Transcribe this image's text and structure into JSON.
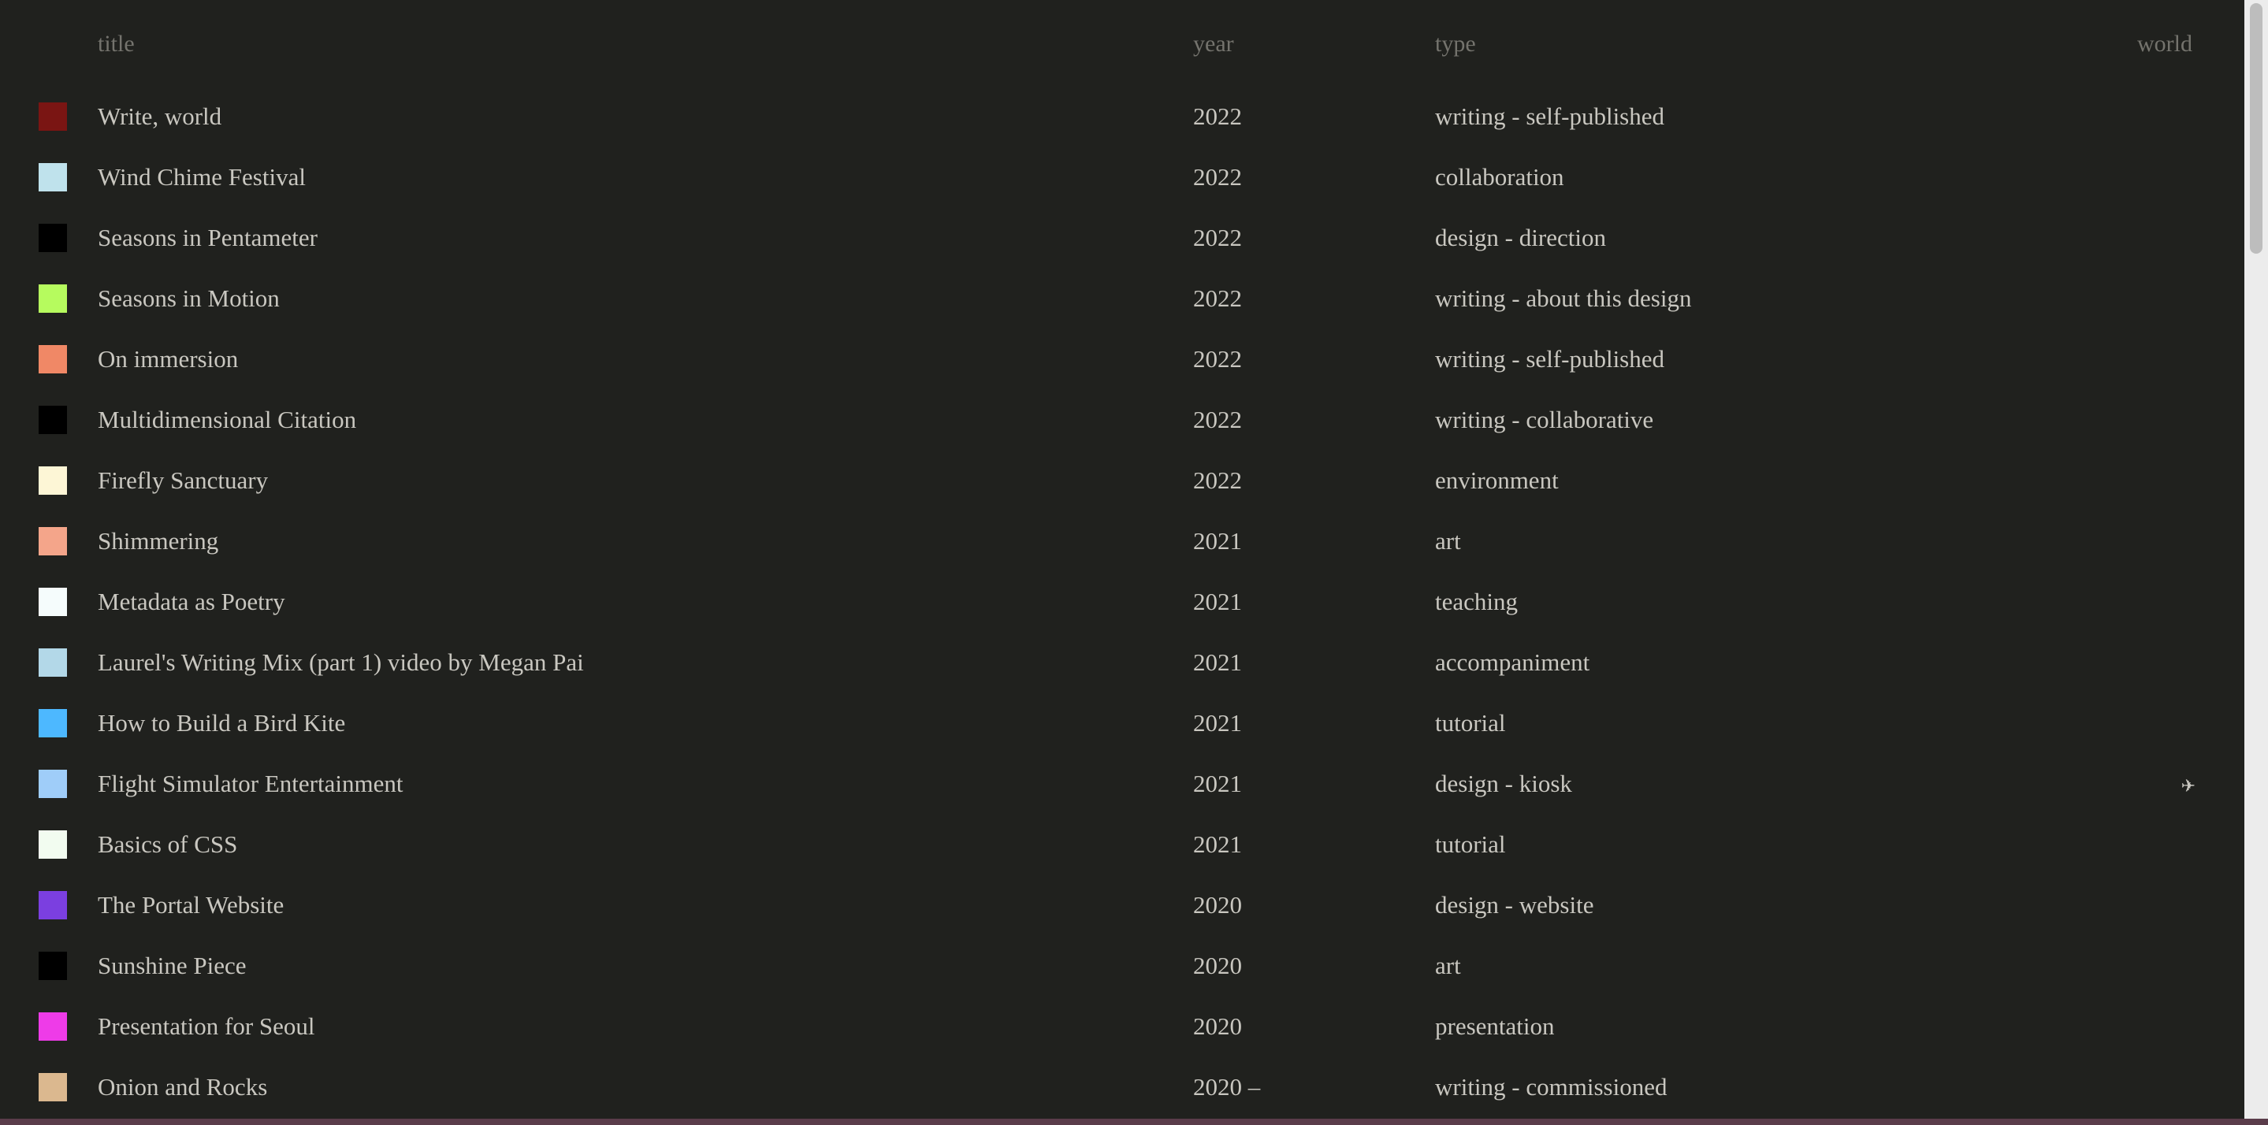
{
  "table": {
    "headers": {
      "title": "title",
      "year": "year",
      "type": "type",
      "world": "world"
    },
    "rows": [
      {
        "color": "#7a1513",
        "title": "Write, world",
        "year": "2022",
        "type": "writing - self-published",
        "world": ""
      },
      {
        "color": "#bfe2ec",
        "title": "Wind Chime Festival",
        "year": "2022",
        "type": "collaboration",
        "world": ""
      },
      {
        "color": "#000000",
        "title": "Seasons in Pentameter",
        "year": "2022",
        "type": "design - direction",
        "world": ""
      },
      {
        "color": "#b6fb5e",
        "title": "Seasons in Motion",
        "year": "2022",
        "type": "writing - about this design",
        "world": ""
      },
      {
        "color": "#f08866",
        "title": "On immersion",
        "year": "2022",
        "type": "writing - self-published",
        "world": ""
      },
      {
        "color": "#000000",
        "title": "Multidimensional Citation",
        "year": "2022",
        "type": "writing - collaborative",
        "world": ""
      },
      {
        "color": "#fdf6d6",
        "title": "Firefly Sanctuary",
        "year": "2022",
        "type": "environment",
        "world": ""
      },
      {
        "color": "#f4a58a",
        "title": "Shimmering",
        "year": "2021",
        "type": "art",
        "world": ""
      },
      {
        "color": "#f5fcfc",
        "title": "Metadata as Poetry",
        "year": "2021",
        "type": "teaching",
        "world": ""
      },
      {
        "color": "#b3d8e8",
        "title": "Laurel's Writing Mix (part 1) video by Megan Pai",
        "year": "2021",
        "type": "accompaniment",
        "world": ""
      },
      {
        "color": "#4db8ff",
        "title": "How to Build a Bird Kite",
        "year": "2021",
        "type": "tutorial",
        "world": ""
      },
      {
        "color": "#9fcdf9",
        "title": "Flight Simulator Entertainment",
        "year": "2021",
        "type": "design - kiosk",
        "world": "✈"
      },
      {
        "color": "#f2fcf0",
        "title": "Basics of CSS",
        "year": "2021",
        "type": "tutorial",
        "world": ""
      },
      {
        "color": "#7b3fe0",
        "title": "The Portal Website",
        "year": "2020",
        "type": "design - website",
        "world": ""
      },
      {
        "color": "#000000",
        "title": "Sunshine Piece",
        "year": "2020",
        "type": "art",
        "world": ""
      },
      {
        "color": "#ee3be8",
        "title": "Presentation for Seoul",
        "year": "2020",
        "type": "presentation",
        "world": ""
      },
      {
        "color": "#dbb88f",
        "title": "Onion and Rocks",
        "year": "2020 –",
        "type": "writing - commissioned",
        "world": ""
      }
    ]
  },
  "colors": {
    "background": "#20211e",
    "text": "#c9c7c0",
    "header_text": "#74736d"
  },
  "icons": {
    "world_marker": "airplane-icon"
  }
}
